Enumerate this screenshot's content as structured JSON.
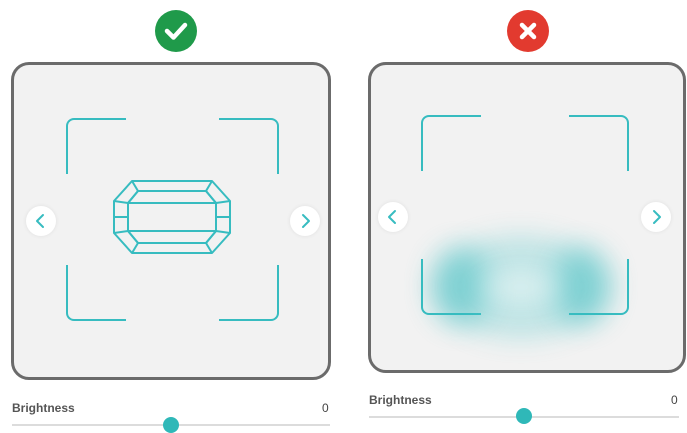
{
  "panels": [
    {
      "status": "correct",
      "status_icon": "checkmark-icon",
      "status_color": "#1f9a4a",
      "brightness": {
        "label": "Brightness",
        "value": "0",
        "level": 0.5
      }
    },
    {
      "status": "incorrect",
      "status_icon": "close-icon",
      "status_color": "#e23a2f",
      "brightness": {
        "label": "Brightness",
        "value": "0",
        "level": 0.5
      }
    }
  ],
  "colors": {
    "accent": "#37bcc0",
    "frame_border": "#6b6b6b",
    "frame_bg": "#f2f2f2"
  },
  "icons": {
    "prev": "chevron-left-icon",
    "next": "chevron-right-icon",
    "gem": "emerald-cut-gem-icon"
  }
}
